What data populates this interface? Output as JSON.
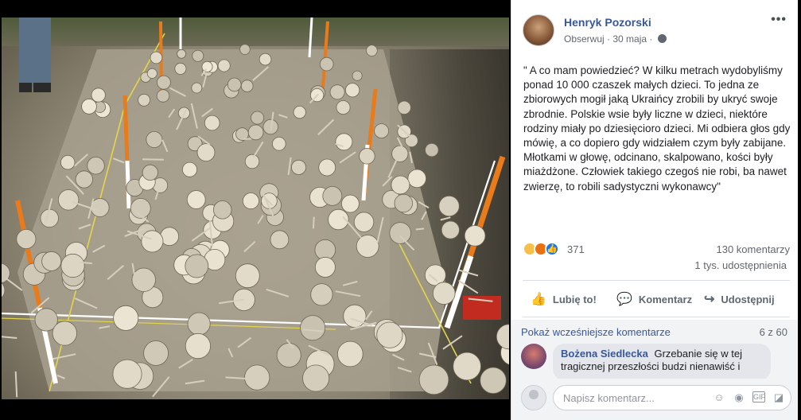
{
  "post": {
    "author": "Henryk Pozorski",
    "follow_label": "Obserwuj",
    "separator": "·",
    "date": "30 maja",
    "privacy_icon": "globe-icon",
    "more_icon": "more-options-icon",
    "text": "\" A co mam powiedzieć? W kilku metrach wydobyliśmy ponad 10 000 czaszek małych dzieci. To jedna ze zbiorowych mogił jaką Ukraińcy zrobili by ukryć swoje zbrodnie. Polskie wsie były liczne w dzieci, niektóre rodziny miały po dziesięcioro dzieci. Mi odbiera głos gdy mówię, a co dopiero gdy widziałem czym były zabijane. Młotkami w głowę, odcinano, skalpowano, kości były miażdżone. Człowiek takiego czegoś nie robi, ba nawet zwierzę, to robili sadystyczni wykonawcy\""
  },
  "reactions": {
    "icons": [
      "sad-reaction-icon",
      "angry-reaction-icon",
      "like-reaction-icon"
    ],
    "count": "371",
    "comments": "130 komentarzy",
    "shares": "1 tys. udostępnienia"
  },
  "actions": {
    "like": "Lubię to!",
    "comment": "Komentarz",
    "share": "Udostępnij"
  },
  "comments": {
    "more_label": "Pokaż wcześniejsze komentarze",
    "page": "6 z 60",
    "items": [
      {
        "author": "Bożena Siedlecka",
        "text": "Grzebanie się w tej tragicznej przeszłości budzi nienawiść i"
      }
    ],
    "compose_placeholder": "Napisz komentarz..."
  },
  "colors": {
    "link": "#385898",
    "text": "#1c1e21",
    "muted": "#616770"
  }
}
